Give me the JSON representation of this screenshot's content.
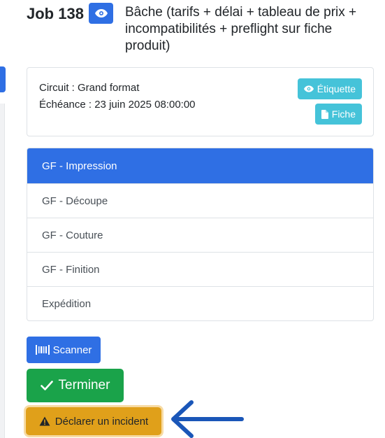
{
  "job": {
    "title": "Job 138",
    "description": "Bâche (tarifs + délai + tableau de prix + incompatibilités + preflight sur fiche produit)",
    "view_icon": "eye-icon"
  },
  "info": {
    "circuit": "Circuit : Grand format",
    "deadline": "Échéance : 23 juin 2025 08:00:00",
    "label_button": "Étiquette",
    "sheet_button": "Fiche"
  },
  "steps": [
    {
      "label": "GF - Impression",
      "active": true
    },
    {
      "label": "GF - Découpe",
      "active": false
    },
    {
      "label": "GF - Couture",
      "active": false
    },
    {
      "label": "GF - Finition",
      "active": false
    },
    {
      "label": "Expédition",
      "active": false
    }
  ],
  "actions": {
    "scan": "Scanner",
    "finish": "Terminer",
    "incident": "Déclarer un incident"
  },
  "colors": {
    "primary": "#2f6fe4",
    "info": "#45c3d9",
    "success": "#1aa34a",
    "warning": "#e0a01a",
    "annotation_arrow": "#1a56b8"
  }
}
